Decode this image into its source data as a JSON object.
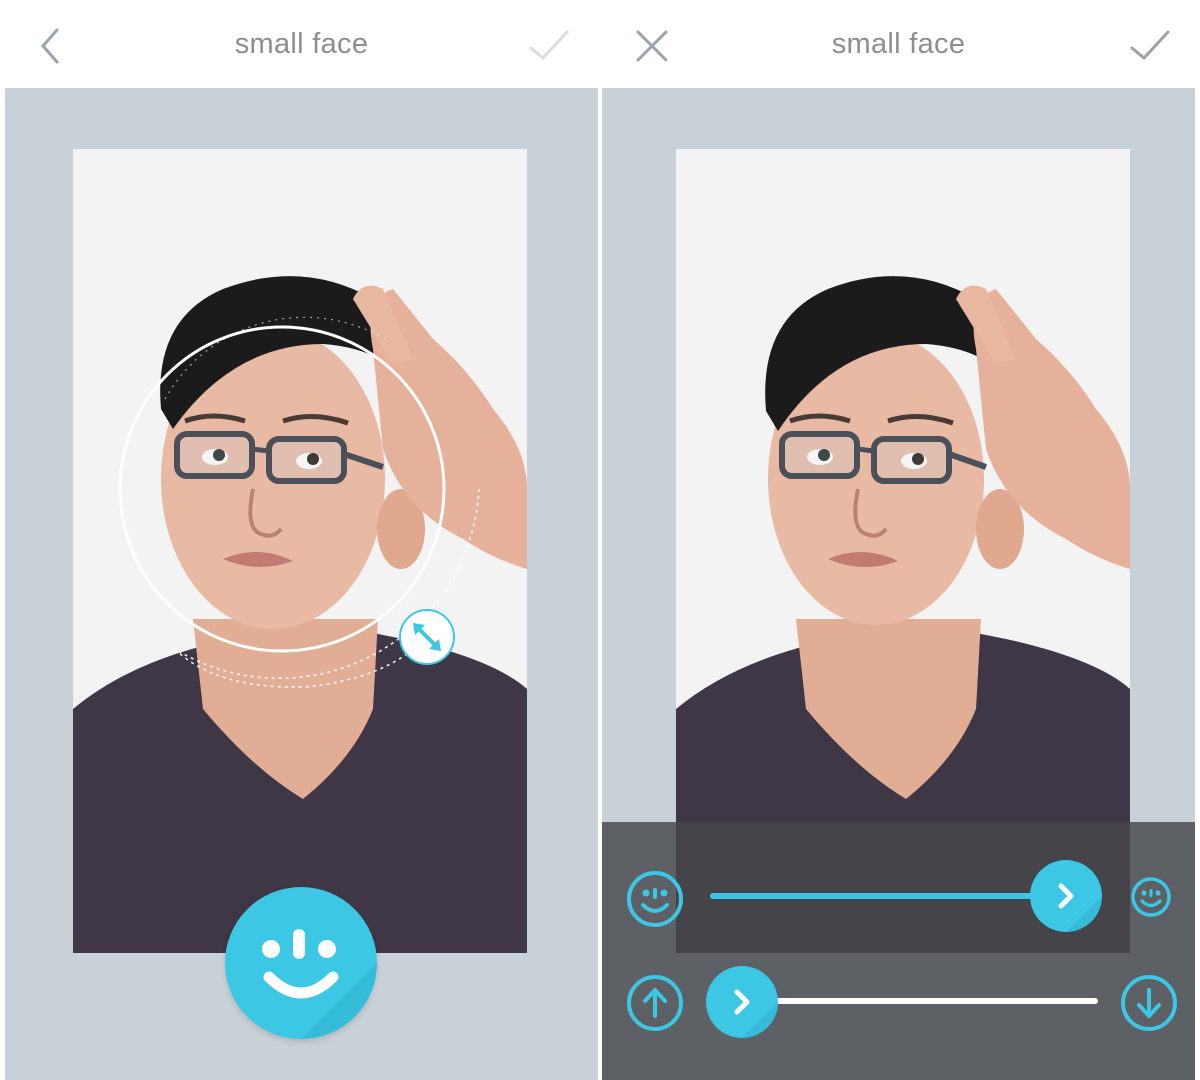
{
  "left_screen": {
    "header": {
      "back_icon": "chevron-left-icon",
      "title": "small face",
      "confirm_icon": "checkmark-icon"
    },
    "face_region_handle_icon": "resize-diagonal-icon",
    "face_button_icon": "smiley-face-icon"
  },
  "right_screen": {
    "header": {
      "close_icon": "close-x-icon",
      "title": "small face",
      "confirm_icon": "checkmark-icon"
    },
    "controls": {
      "face_size_slider": {
        "start_icon": "smiley-large-icon",
        "end_icon": "smiley-small-icon",
        "value": 0.92
      },
      "face_position_slider": {
        "start_icon": "arrow-up-circle-icon",
        "end_icon": "arrow-down-circle-icon",
        "value": 0.08
      }
    }
  },
  "colors": {
    "accent": "#3cc7e4",
    "header_text": "#8e8e8e",
    "icon_gray": "#9aa3ad",
    "canvas_bg": "#c8d0d8",
    "shirt": "#3f3646",
    "hair": "#1c1b1c",
    "skin": "#e6b49d"
  }
}
